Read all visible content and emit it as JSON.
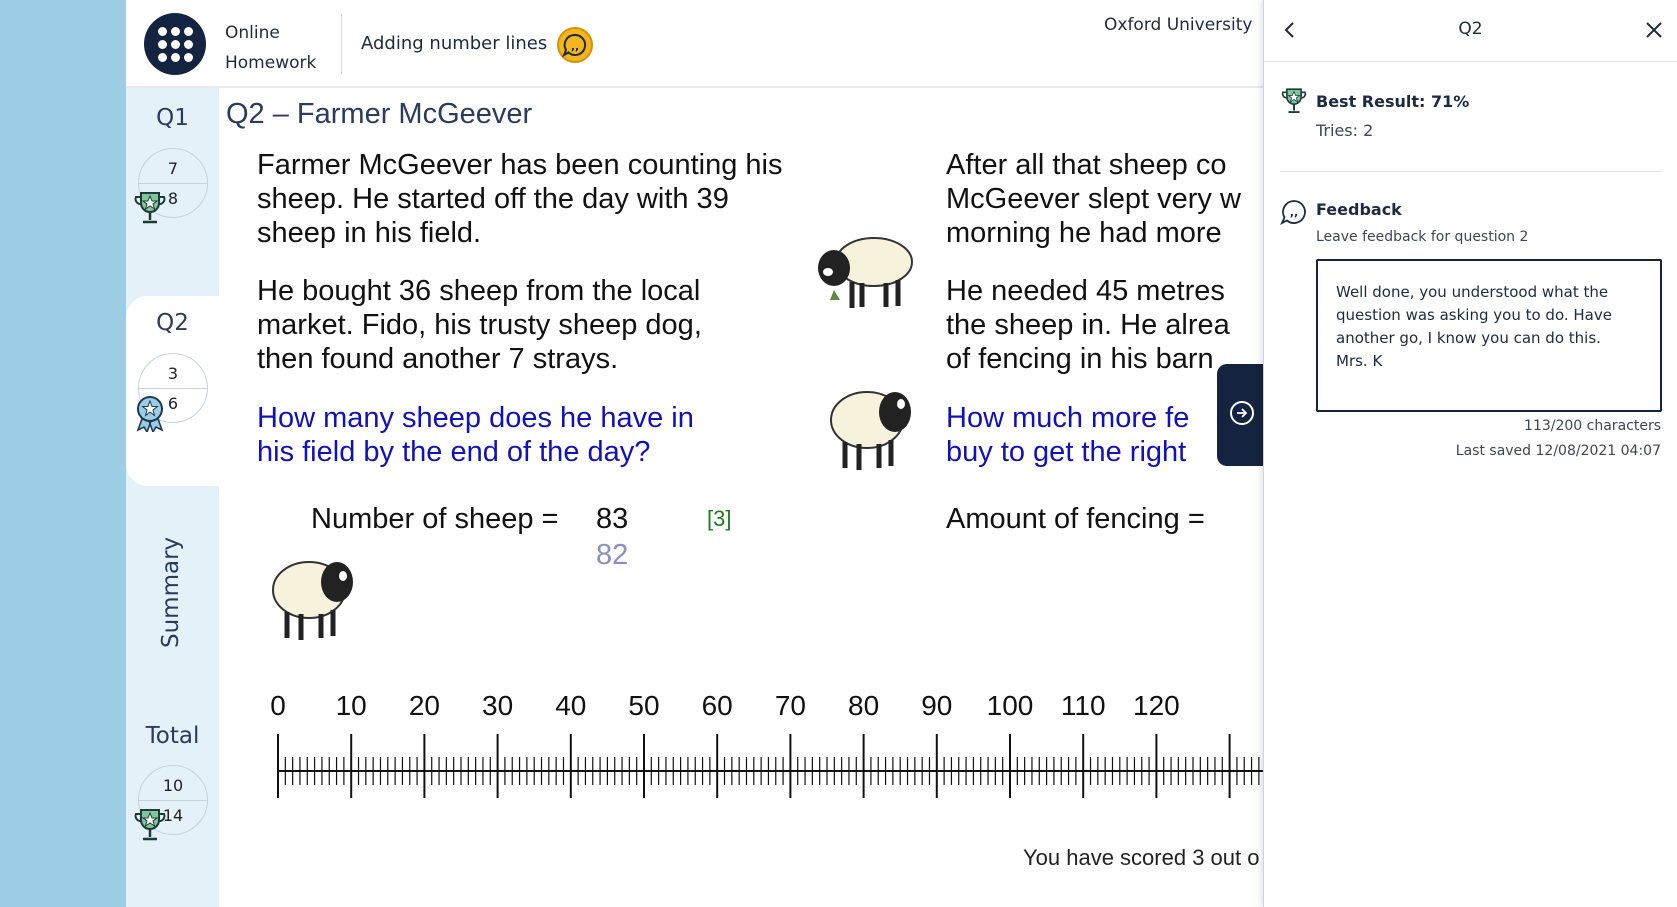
{
  "header": {
    "app_name_line1": "Online",
    "app_name_line2": "Homework",
    "homework_title": "Adding number lines",
    "organisation": "Oxford University"
  },
  "nav": {
    "q1": {
      "label": "Q1",
      "score": "7",
      "max": "8"
    },
    "q2": {
      "label": "Q2",
      "score": "3",
      "max": "6"
    },
    "summary": {
      "label": "Summary"
    },
    "total": {
      "label": "Total",
      "score": "10",
      "max": "14"
    }
  },
  "question": {
    "title": "Q2 – Farmer McGeever",
    "left": {
      "p1": [
        "Farmer McGeever has been counting his",
        "sheep. He started off the day with 39",
        "sheep in his field."
      ],
      "p2": [
        "He bought 36 sheep from the local",
        "market. Fido, his trusty sheep dog,",
        "then found another 7 strays."
      ],
      "q": [
        "How many sheep does he have in",
        "his field by the end of the day?"
      ],
      "answer_label": "Number of sheep =",
      "answer_value": "83",
      "previous_answer": "82",
      "marks": "[3]"
    },
    "right": {
      "p1": [
        "After all that sheep co",
        "McGeever slept very w",
        "morning he had more"
      ],
      "p2": [
        "He needed 45 metres",
        "the sheep in. He alrea",
        "of fencing in his barn"
      ],
      "q": [
        "How much more fe",
        "buy to get the right"
      ],
      "answer_label": "Amount of fencing ="
    },
    "number_line": {
      "labels": [
        "0",
        "10",
        "20",
        "30",
        "40",
        "50",
        "60",
        "70",
        "80",
        "90",
        "100",
        "110",
        "120"
      ]
    },
    "score_text": "You have scored 3 out o"
  },
  "panel": {
    "title": "Q2",
    "best_result": "Best Result: 71%",
    "tries": "Tries: 2",
    "feedback_title": "Feedback",
    "feedback_sub": "Leave feedback for question 2",
    "feedback_text": "Well done, you understood what the question was asking you to do. Have another go, I know you can do this.\nMrs. K",
    "char_count": "113/200 characters",
    "last_saved": "Last saved 12/08/2021 04:07"
  },
  "colors": {
    "navy": "#14233f",
    "sky": "#9ccde4",
    "question_blue": "#1111b8",
    "accent_gold": "#f4b51f",
    "award_green": "#3c7d5a"
  }
}
